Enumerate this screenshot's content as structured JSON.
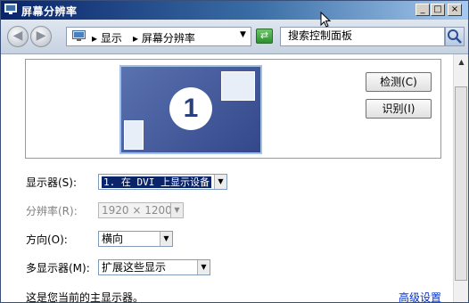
{
  "window": {
    "title": "屏幕分辨率",
    "caption_buttons": {
      "minimize": "_",
      "maximize": "□",
      "close": "×"
    }
  },
  "addressbar": {
    "breadcrumb": [
      "显示",
      "屏幕分辨率"
    ],
    "search_placeholder": "搜索控制面板"
  },
  "preview": {
    "monitor_number": "1"
  },
  "buttons": {
    "detect": "检测(C)",
    "identify": "识别(I)"
  },
  "form": {
    "display_label": "显示器(S):",
    "display_value": "1. 在 DVI 上显示设备",
    "resolution_label": "分辨率(R):",
    "resolution_value": "1920 × 1200",
    "orientation_label": "方向(O):",
    "orientation_value": "横向",
    "multi_label": "多显示器(M):",
    "multi_value": "扩展这些显示"
  },
  "footer": {
    "status_text": "这是您当前的主显示器。",
    "advanced_link": "高级设置"
  },
  "colors": {
    "title_bar": "#0a246a",
    "link": "#0033cc",
    "selection": "#0a246a"
  }
}
